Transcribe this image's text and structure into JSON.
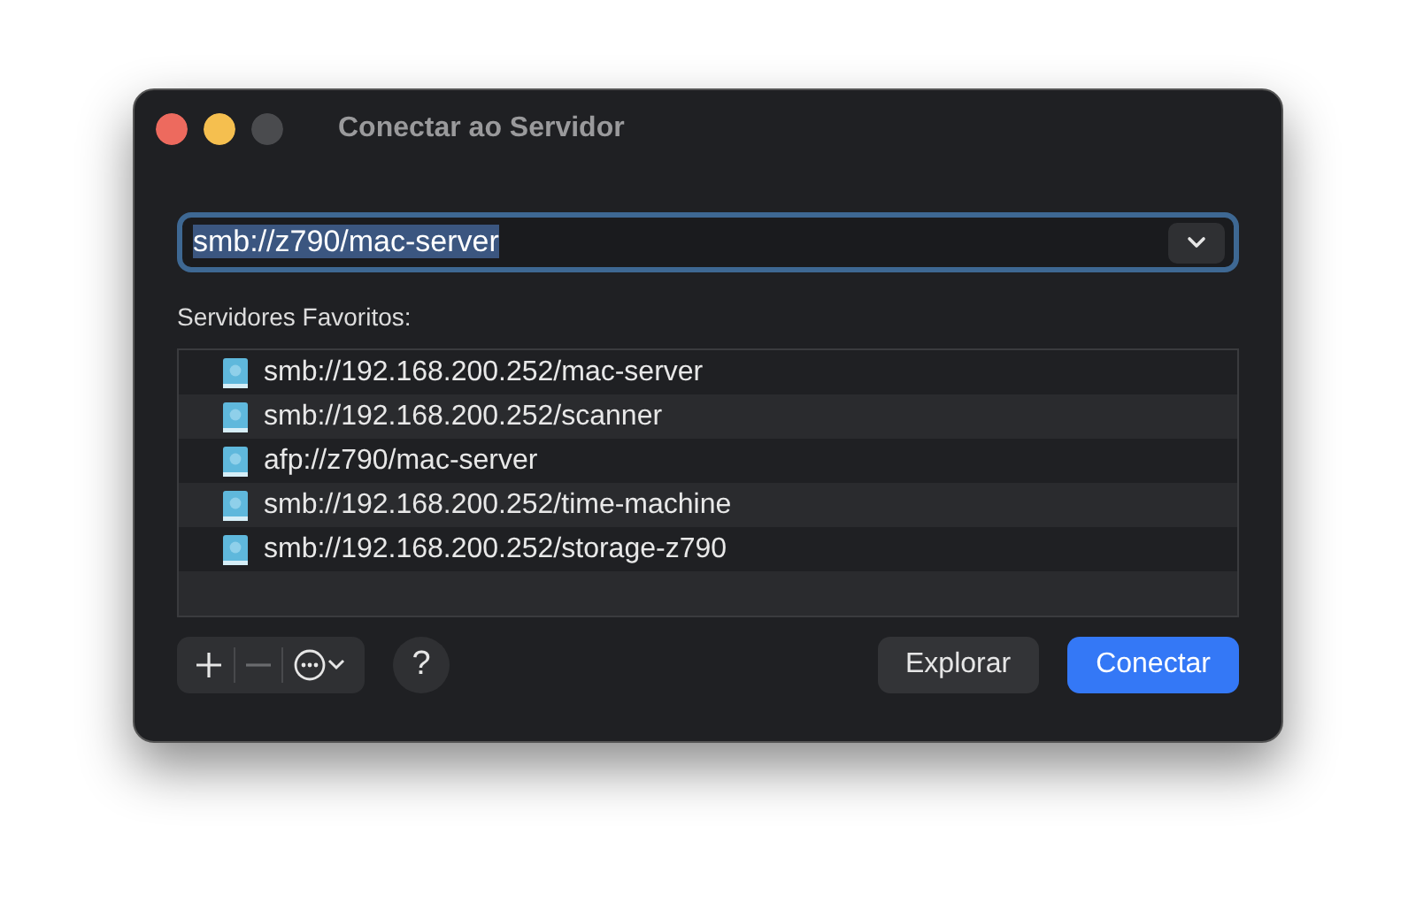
{
  "window": {
    "title": "Conectar ao Servidor"
  },
  "address_field": {
    "value": "smb://z790/mac-server",
    "text_selected": true,
    "focused": true
  },
  "favorites": {
    "label": "Servidores Favoritos:",
    "items": [
      {
        "address": "smb://192.168.200.252/mac-server"
      },
      {
        "address": "smb://192.168.200.252/scanner"
      },
      {
        "address": "afp://z790/mac-server"
      },
      {
        "address": "smb://192.168.200.252/time-machine"
      },
      {
        "address": "smb://192.168.200.252/storage-z790"
      }
    ]
  },
  "toolbar": {
    "remove_disabled": true,
    "help": "?"
  },
  "buttons": [
    {
      "label": "Explorar",
      "kind": "secondary"
    },
    {
      "label": "Conectar",
      "kind": "primary"
    }
  ]
}
